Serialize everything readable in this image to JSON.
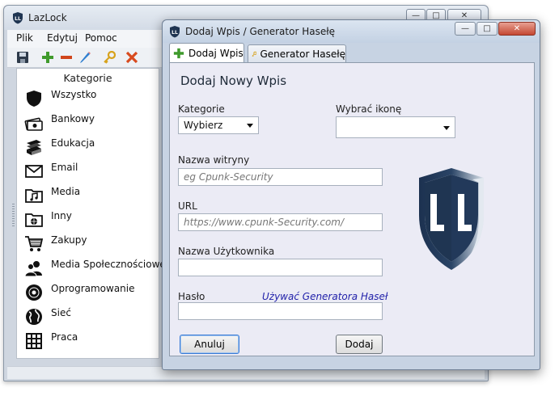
{
  "main_window": {
    "title": "LazLock",
    "menu": [
      "Plik",
      "Edytuj",
      "Pomoc"
    ],
    "toolbar_icons": [
      "save-icon",
      "add-icon",
      "remove-icon",
      "edit-icon",
      "key-icon",
      "delete-icon"
    ],
    "category_header": "Kategorie",
    "categories": [
      {
        "label": "Wszystko",
        "icon": "shield-icon"
      },
      {
        "label": "Bankowy",
        "icon": "money-icon"
      },
      {
        "label": "Edukacja",
        "icon": "books-icon"
      },
      {
        "label": "Email",
        "icon": "envelope-icon"
      },
      {
        "label": "Media",
        "icon": "music-folder-icon"
      },
      {
        "label": "Inny",
        "icon": "globe-folder-icon"
      },
      {
        "label": "Zakupy",
        "icon": "cart-icon"
      },
      {
        "label": "Media Społecznościowe",
        "icon": "people-icon"
      },
      {
        "label": "Oprogramowanie",
        "icon": "disc-icon"
      },
      {
        "label": "Sieć",
        "icon": "globe-icon"
      },
      {
        "label": "Praca",
        "icon": "calculator-icon"
      }
    ]
  },
  "dialog": {
    "title": "Dodaj Wpis / Generator Hasełę",
    "tabs": [
      {
        "label": "Dodaj Wpis",
        "icon": "add-icon",
        "active": true
      },
      {
        "label": "Generator Hasełę",
        "icon": "key-icon",
        "active": false
      }
    ],
    "heading": "Dodaj Nowy Wpis",
    "category_label": "Kategorie",
    "category_value": "Wybierz",
    "icon_label": "Wybrać ikonę",
    "icon_value": "",
    "site_label": "Nazwa witryny",
    "site_placeholder": "eg Cpunk-Security",
    "url_label": "URL",
    "url_placeholder": "https://www.cpunk-Security.com/",
    "user_label": "Nazwa Użytkownika",
    "user_value": "",
    "password_label": "Hasło",
    "password_value": "",
    "generator_link": "Używać Generatora Haseł",
    "cancel_button": "Anuluj",
    "add_button": "Dodaj",
    "logo_letters": "L L"
  },
  "colors": {
    "shield_navy": "#1f3552",
    "shield_light": "#dfe6ee",
    "link_blue": "#2222aa",
    "close_red": "#c44732"
  }
}
